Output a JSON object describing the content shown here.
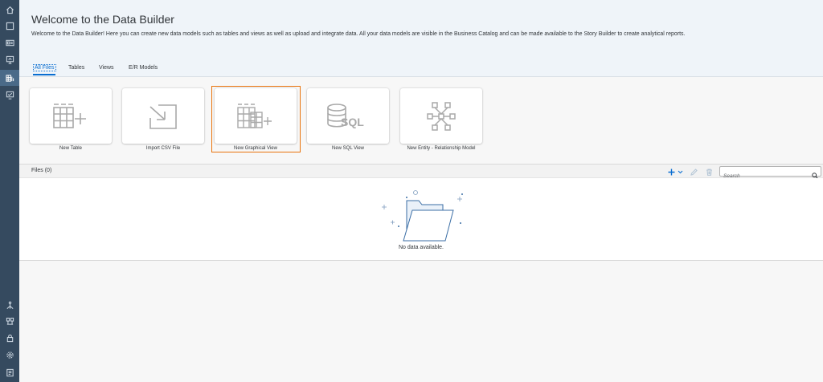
{
  "sidebar": {
    "items": [
      {
        "icon": "home-icon"
      },
      {
        "icon": "square-icon"
      },
      {
        "icon": "id-card-icon"
      },
      {
        "icon": "presentation-icon"
      },
      {
        "icon": "data-builder-icon",
        "active": true
      },
      {
        "icon": "monitor-icon"
      },
      {
        "icon": "network-icon"
      },
      {
        "icon": "hierarchy-icon"
      },
      {
        "icon": "lock-icon"
      },
      {
        "icon": "gear-icon"
      },
      {
        "icon": "document-icon"
      }
    ]
  },
  "header": {
    "title": "Welcome to the Data Builder",
    "description": "Welcome to the Data Builder! Here you can create new data models such as tables and views as well as upload and integrate data. All your data models are visible in the Business Catalog and can be made available to the Story Builder to create analytical reports."
  },
  "tabs": [
    {
      "label": "All Files",
      "selected": true
    },
    {
      "label": "Tables"
    },
    {
      "label": "Views"
    },
    {
      "label": "E/R Models"
    }
  ],
  "tiles": [
    {
      "label": "New Table",
      "icon": "table-add-icon"
    },
    {
      "label": "Import CSV File",
      "icon": "import-icon"
    },
    {
      "label": "New Graphical View",
      "icon": "graphical-view-icon",
      "highlighted": true
    },
    {
      "label": "New SQL View",
      "icon": "sql-icon"
    },
    {
      "label": "New Entity - Relationship Model",
      "icon": "er-model-icon"
    }
  ],
  "files": {
    "title": "Files (0)",
    "search_placeholder": "Search",
    "empty_text": "No data available."
  },
  "colors": {
    "shell": "#354a5f",
    "header_bg": "#eff4f9",
    "accent": "#0a6ed1",
    "highlight": "#e9730c",
    "icon_gray": "#a9a9a9"
  }
}
